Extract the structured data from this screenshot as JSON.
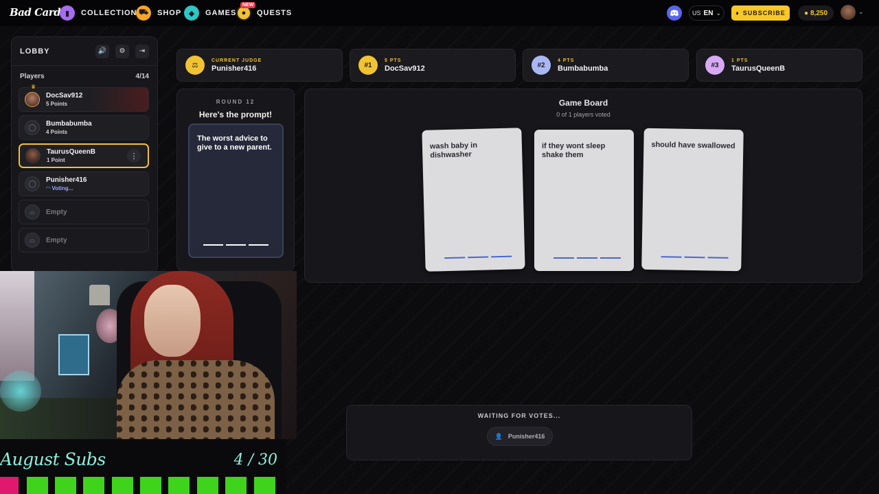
{
  "nav": {
    "logo": "Bad Cards",
    "items": [
      {
        "label": "COLLECTION",
        "icon": "cards-icon",
        "color": "#a86cf0"
      },
      {
        "label": "SHOP",
        "icon": "cart-icon",
        "color": "#f5a425"
      },
      {
        "label": "GAMES",
        "icon": "games-icon",
        "color": "#2ec6c6"
      },
      {
        "label": "QUESTS",
        "icon": "quest-icon",
        "color": "#f1c232",
        "tag": "NEW"
      }
    ],
    "lang_region": "US",
    "lang_code": "EN",
    "subscribe_label": "SUBSCRIBE",
    "coins": "8,250"
  },
  "lobby": {
    "title": "LOBBY",
    "players_label": "Players",
    "players_count": "4/14",
    "players": [
      {
        "name": "DocSav912",
        "sub": "5 Points"
      },
      {
        "name": "Bumbabumba",
        "sub": "4 Points"
      },
      {
        "name": "TaurusQueenB",
        "sub": "1 Point"
      },
      {
        "name": "Punisher416",
        "sub": "Voting..."
      }
    ],
    "empty_label": "Empty"
  },
  "scores": {
    "judge_label": "CURRENT JUDGE",
    "judge_name": "Punisher416",
    "ranks": [
      {
        "rank": "#1",
        "pts": "5 PTS",
        "name": "DocSav912",
        "color": "#f1c232"
      },
      {
        "rank": "#2",
        "pts": "4 PTS",
        "name": "Bumbabumba",
        "color": "#a9b7f5"
      },
      {
        "rank": "#3",
        "pts": "1 PTS",
        "name": "TaurusQueenB",
        "color": "#d7a9f5"
      }
    ]
  },
  "prompt": {
    "round": "ROUND 12",
    "heading": "Here's the prompt!",
    "card_text": "The worst advice to give to a new parent."
  },
  "board": {
    "title": "Game Board",
    "subtitle": "0 of 1 players voted",
    "cards": [
      "wash baby in dishwasher",
      "if they wont sleep shake them",
      "should have swallowed"
    ]
  },
  "waiting": {
    "label": "WAITING FOR VOTES...",
    "player": "Punisher416"
  },
  "stream": {
    "subs_title": "August Subs",
    "subs_count": "4 / 30",
    "filled_color": "#3fd31b",
    "current_color": "#e0186e"
  }
}
